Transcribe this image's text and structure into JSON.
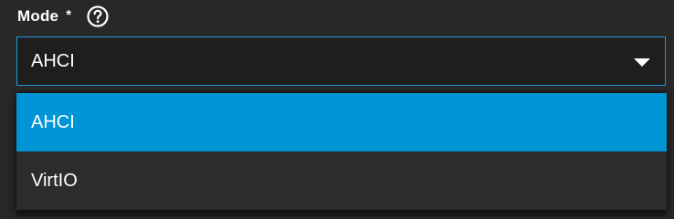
{
  "field": {
    "label": "Mode",
    "required_mark": "*",
    "help_icon": "help-circle-icon"
  },
  "select": {
    "value": "AHCI",
    "caret_icon": "chevron-down-icon",
    "border_color": "#1f9ad6"
  },
  "dropdown": {
    "options": [
      {
        "label": "AHCI",
        "selected": true
      },
      {
        "label": "VirtIO",
        "selected": false
      }
    ],
    "selected_color": "#0095d5"
  }
}
